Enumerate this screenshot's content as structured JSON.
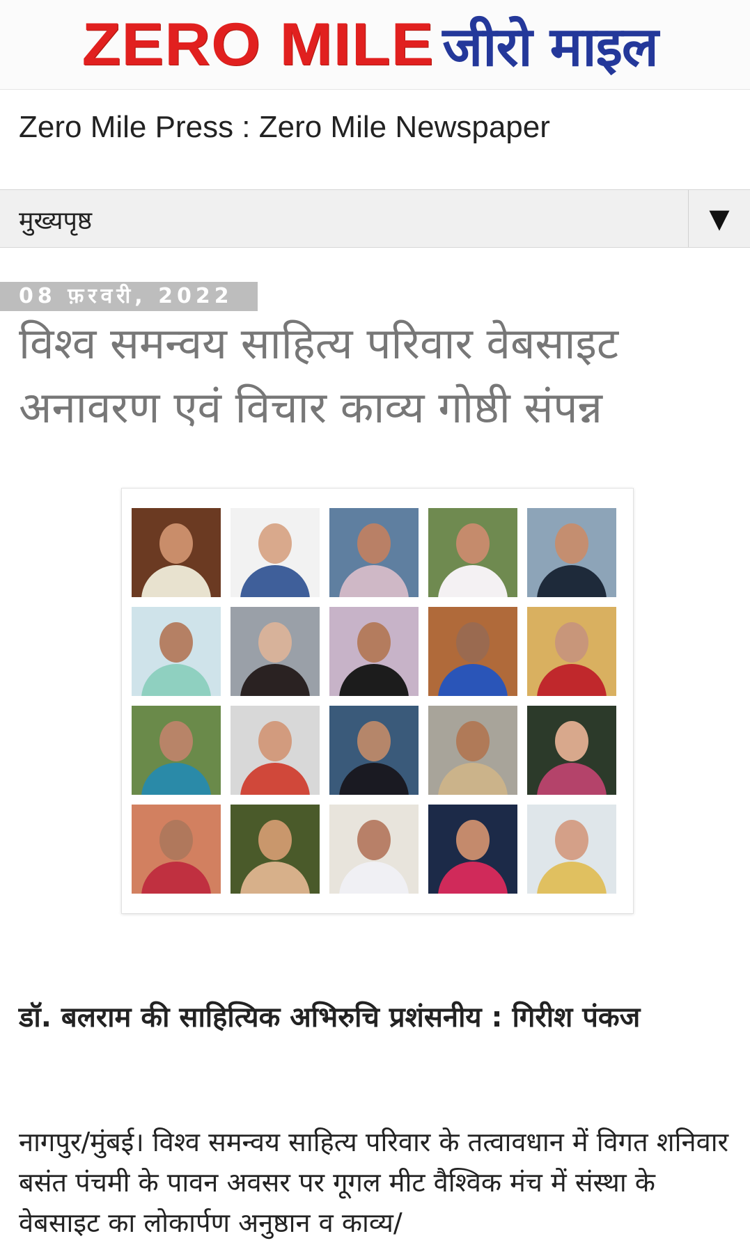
{
  "header": {
    "logo_en": "ZERO MILE",
    "logo_hi": "जीरो माइल",
    "site_title": "Zero Mile Press : Zero Mile Newspaper"
  },
  "nav": {
    "menu_label": "मुख्यपृष्ठ",
    "toggle_icon": "▼"
  },
  "post": {
    "date": "08 फ़रवरी, 2022",
    "title": "विश्व समन्वय साहित्य परिवार वेबसाइट अनावरण एवं विचार काव्य गोष्ठी संपन्न",
    "subheading": "डॉ. बलराम की साहित्यिक अभिरुचि प्रशंसनीय : गिरीश पंकज",
    "paragraph": "नागपुर/मुंबई। विश्व समन्वय साहित्य परिवार के तत्वावधान में विगत शनिवार बसंत पंचमी के पावन अवसर पर गूगल मीट वैश्विक मंच में संस्था के वेबसाइट का लोकार्पण अनुष्ठान व काव्य/"
  },
  "colors": {
    "logo_red": "#e1201f",
    "logo_blue": "#24389a",
    "date_bg": "#bdbdbd",
    "title_gray": "#777777"
  },
  "photos": [
    {
      "bg": "#6b3a22",
      "skin": "#c98d6a",
      "cloth": "#e8e2cf"
    },
    {
      "bg": "#f2f2f2",
      "skin": "#d9a98c",
      "cloth": "#3f5f9a"
    },
    {
      "bg": "#5f7fa0",
      "skin": "#b98066",
      "cloth": "#cfb8c6"
    },
    {
      "bg": "#6f8a50",
      "skin": "#c58b6c",
      "cloth": "#f4f1f3"
    },
    {
      "bg": "#8da4b8",
      "skin": "#c48e70",
      "cloth": "#1e2a3a"
    },
    {
      "bg": "#cfe3ea",
      "skin": "#b58064",
      "cloth": "#8fd0c0"
    },
    {
      "bg": "#9aa0a8",
      "skin": "#d7b29a",
      "cloth": "#2a2222"
    },
    {
      "bg": "#c7b3c8",
      "skin": "#b47c5e",
      "cloth": "#1c1c1c"
    },
    {
      "bg": "#b06a3a",
      "skin": "#9a6a50",
      "cloth": "#2a55b8"
    },
    {
      "bg": "#d9b060",
      "skin": "#c8967a",
      "cloth": "#c0282c"
    },
    {
      "bg": "#6a8a4a",
      "skin": "#b88468",
      "cloth": "#2a8aa8"
    },
    {
      "bg": "#d8d8d8",
      "skin": "#d29b7e",
      "cloth": "#d0483a"
    },
    {
      "bg": "#3a5a7a",
      "skin": "#b5866a",
      "cloth": "#1a1a22"
    },
    {
      "bg": "#a8a49a",
      "skin": "#b07a58",
      "cloth": "#cbb38a"
    },
    {
      "bg": "#2c3a2a",
      "skin": "#d8a88c",
      "cloth": "#b4436a"
    },
    {
      "bg": "#d28060",
      "skin": "#b0785c",
      "cloth": "#c03040"
    },
    {
      "bg": "#4a5a2a",
      "skin": "#c9976c",
      "cloth": "#d7b08a"
    },
    {
      "bg": "#e8e4dc",
      "skin": "#b88068",
      "cloth": "#f0f0f4"
    },
    {
      "bg": "#1c2a48",
      "skin": "#c48a6c",
      "cloth": "#d02a5a"
    },
    {
      "bg": "#dfe6ea",
      "skin": "#d4a088",
      "cloth": "#e0c060"
    }
  ]
}
